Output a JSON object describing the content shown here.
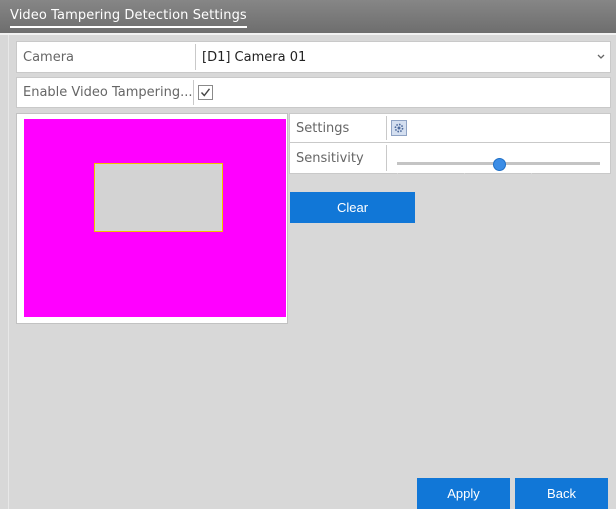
{
  "title": "Video Tampering Detection Settings",
  "camera": {
    "label": "Camera",
    "value": "[D1] Camera 01"
  },
  "enable": {
    "label": "Enable Video Tampering...",
    "checked": true
  },
  "settings": {
    "label": "Settings"
  },
  "sensitivity": {
    "label": "Sensitivity",
    "value_fraction": 0.5
  },
  "buttons": {
    "clear": "Clear",
    "apply": "Apply",
    "back": "Back"
  },
  "colors": {
    "accent": "#1177d7",
    "preview_fill": "#ff00ff",
    "region_border": "#f0c000"
  }
}
